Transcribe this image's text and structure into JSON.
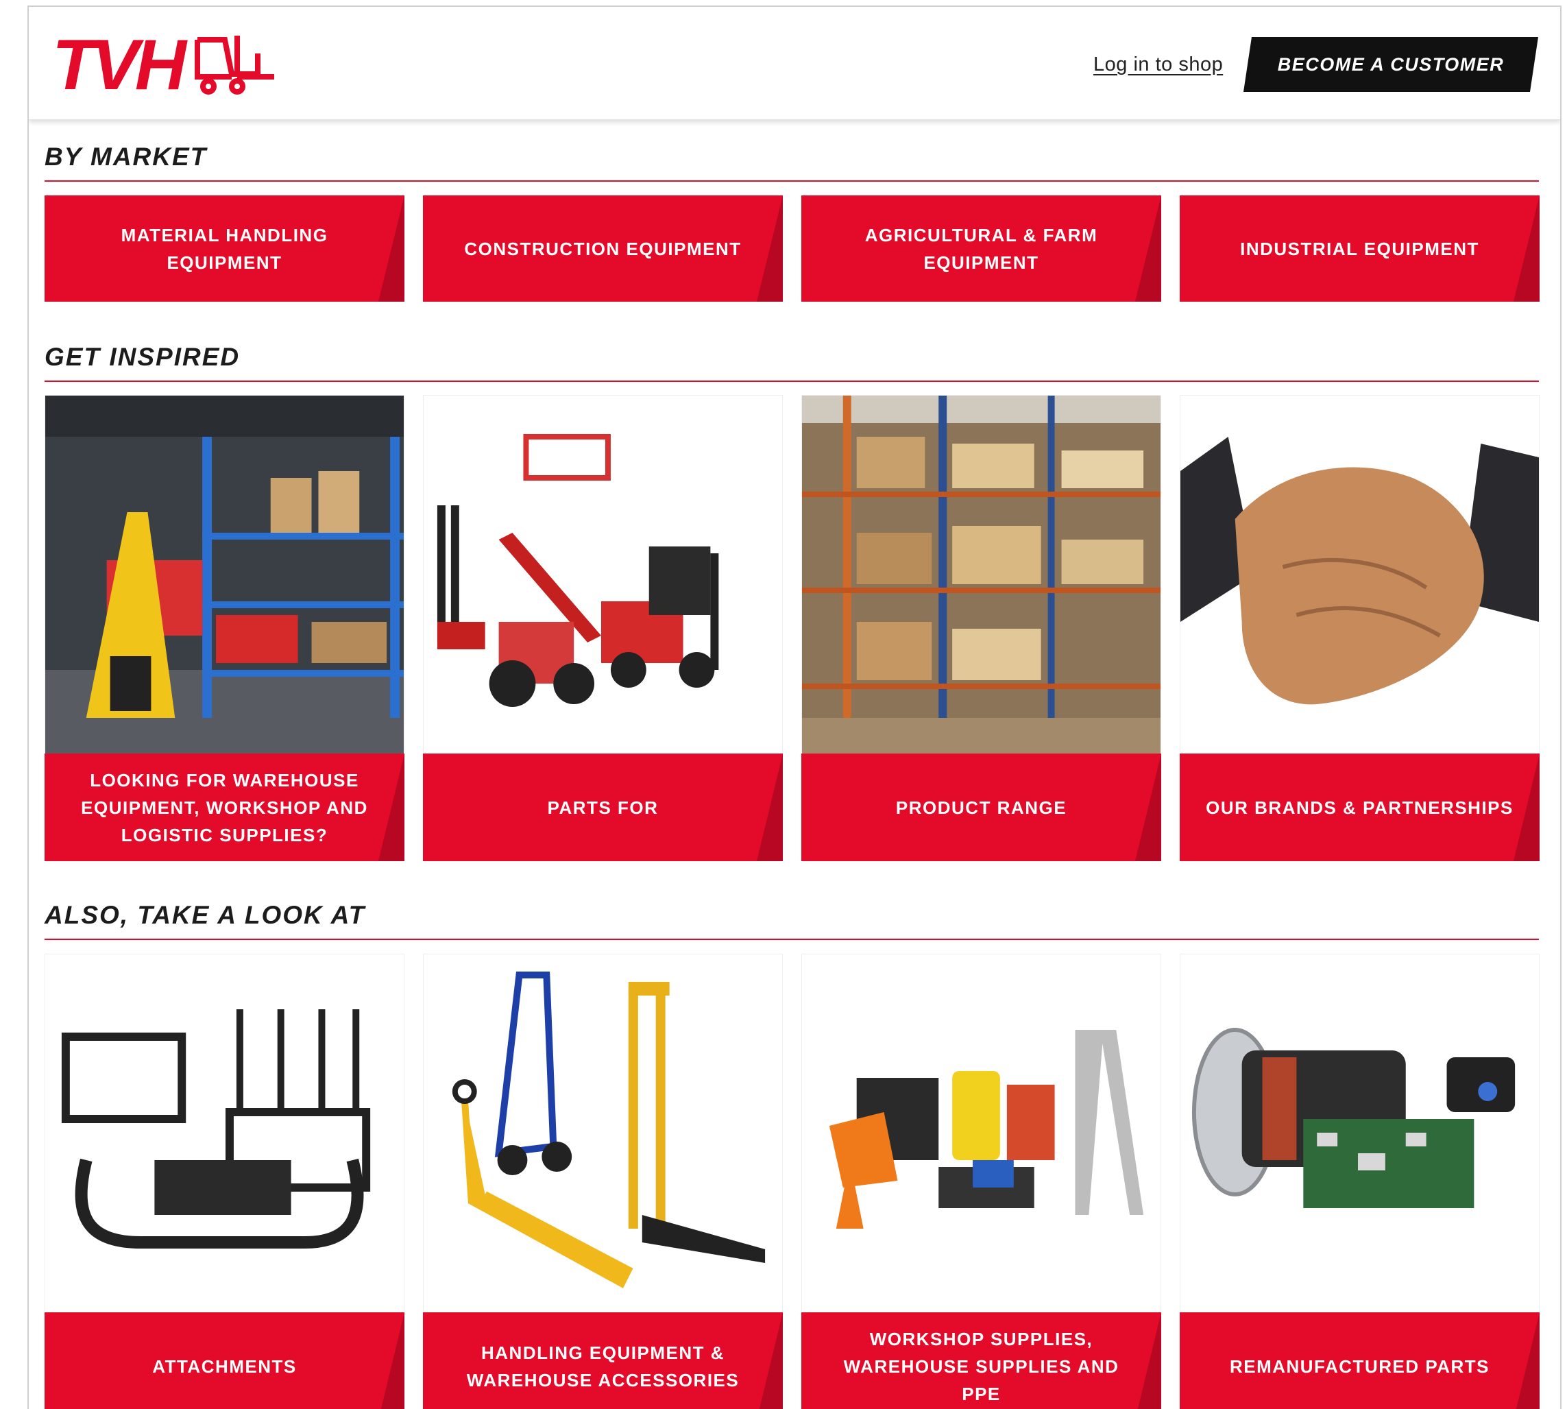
{
  "header": {
    "logo_text": "TVH",
    "login_label": "Log in to shop",
    "become_customer_label": "BECOME A CUSTOMER"
  },
  "sections": {
    "by_market": {
      "title": "BY MARKET",
      "items": [
        {
          "label": "MATERIAL HANDLING EQUIPMENT"
        },
        {
          "label": "CONSTRUCTION EQUIPMENT"
        },
        {
          "label": "AGRICULTURAL & FARM EQUIPMENT"
        },
        {
          "label": "INDUSTRIAL EQUIPMENT"
        }
      ]
    },
    "get_inspired": {
      "title": "GET INSPIRED",
      "items": [
        {
          "label": "LOOKING FOR WAREHOUSE EQUIPMENT, WORKSHOP AND LOGISTIC SUPPLIES?",
          "image": "warehouse-workshop-photo"
        },
        {
          "label": "PARTS FOR",
          "image": "machinery-lineup-photo"
        },
        {
          "label": "PRODUCT RANGE",
          "image": "warehouse-shelves-photo"
        },
        {
          "label": "OUR BRANDS & PARTNERSHIPS",
          "image": "handshake-photo"
        }
      ]
    },
    "take_a_look": {
      "title": "ALSO, TAKE A LOOK AT",
      "items": [
        {
          "label": "ATTACHMENTS",
          "image": "forklift-attachments-photo"
        },
        {
          "label": "HANDLING EQUIPMENT & WAREHOUSE ACCESSORIES",
          "image": "hand-trucks-pallet-jack-photo"
        },
        {
          "label": "WORKSHOP SUPPLIES, WAREHOUSE SUPPLIES AND PPE",
          "image": "workshop-supplies-photo"
        },
        {
          "label": "REMANUFACTURED PARTS",
          "image": "motor-controller-photo"
        }
      ]
    }
  },
  "colors": {
    "brand_red": "#e30a2a",
    "button_black": "#111111",
    "title_dark": "#1c1c1c"
  }
}
